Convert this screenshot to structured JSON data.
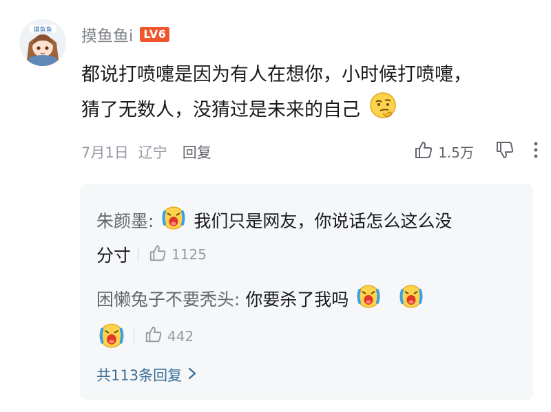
{
  "comment": {
    "username": "摸鱼鱼i",
    "level_badge": "LV6",
    "text_line1": "都说打喷嚏是因为有人在想你，小时候打喷嚏，",
    "text_line2": "猜了无数人，没猜过是未来的自己",
    "emoji": "thinking-face",
    "date": "7月1日",
    "location": "辽宁",
    "reply_label": "回复",
    "like_count": "1.5万",
    "avatar_text": "摸鱼鱼"
  },
  "replies": [
    {
      "name": "朱颜墨:",
      "text_line1": "我们只是网友，你说话怎么这么没",
      "text_line2": "分寸",
      "like_count": "1125",
      "emoji": "crying-face"
    },
    {
      "name": "困懒兔子不要秃头:",
      "text_line1": "你要杀了我吗",
      "like_count": "442",
      "emoji": "crying-face"
    }
  ],
  "more_replies_label": "共113条回复",
  "colors": {
    "level_badge": "#f0562e",
    "link": "#3a6f99",
    "muted": "#9499a0",
    "reply_bg": "#f6f7f8"
  }
}
